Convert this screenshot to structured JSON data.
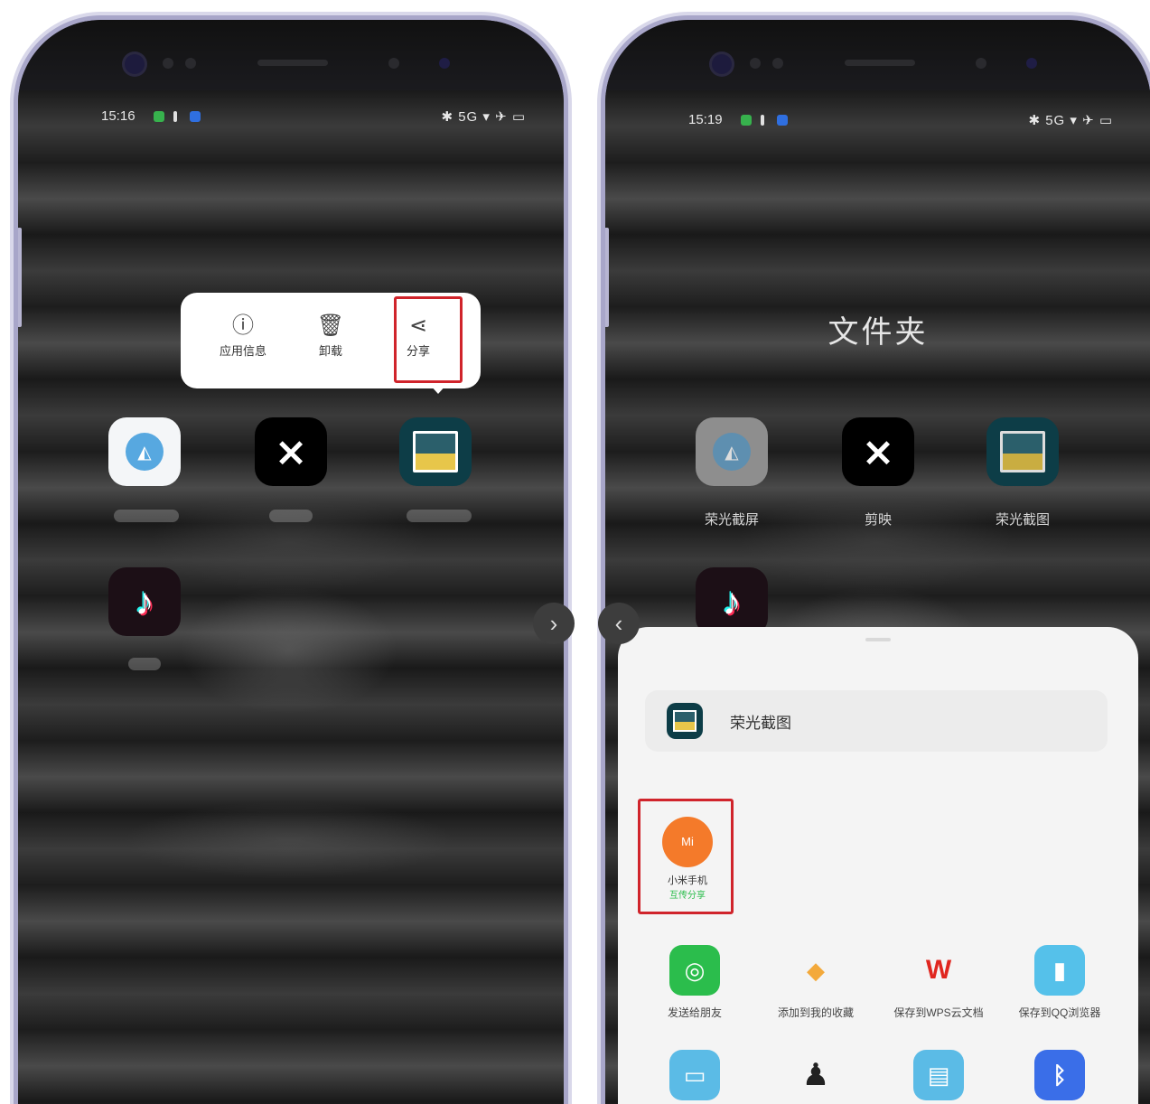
{
  "left": {
    "status": {
      "time": "15:16",
      "right": "✱ 5G ▾ ✈ ▭"
    },
    "context_menu": {
      "items": [
        {
          "label": "应用信息",
          "icon": "info-icon"
        },
        {
          "label": "卸载",
          "icon": "trash-icon"
        },
        {
          "label": "分享",
          "icon": "share-icon"
        }
      ]
    }
  },
  "right": {
    "status": {
      "time": "15:19",
      "right": "✱ 5G ▾ ✈ ▭"
    },
    "folder_title": "文件夹",
    "apps": [
      {
        "label": "荣光截屏"
      },
      {
        "label": "剪映"
      },
      {
        "label": "荣光截图"
      }
    ],
    "share_sheet": {
      "source_app": "荣光截图",
      "highlighted_target": {
        "line1": "小米手机",
        "line2": "互传分享",
        "avatar": "Mi"
      },
      "targets_row1": [
        {
          "label": "发送给朋友",
          "icon": "wechat-icon",
          "color": "#2bbd4c"
        },
        {
          "label": "添加到我的收藏",
          "icon": "box-icon",
          "color": "#f3a93b"
        },
        {
          "label": "保存到WPS云文档",
          "icon": "wps-icon",
          "color": "#e0261f"
        },
        {
          "label": "保存到QQ浏览器",
          "icon": "bookmark-icon",
          "color": "#55c1ea"
        }
      ],
      "targets_row2": [
        {
          "label": "",
          "icon": "screen-icon",
          "color": "#5bbbe6"
        },
        {
          "label": "",
          "icon": "qq-icon",
          "color": "#222222"
        },
        {
          "label": "",
          "icon": "folder-icon",
          "color": "#5bbbe6"
        },
        {
          "label": "",
          "icon": "bluetooth-icon",
          "color": "#3a6ee8"
        }
      ]
    }
  },
  "colors": {
    "highlight": "#d0242b",
    "frame": "#a8a6c9",
    "sheet": "#f4f4f4"
  }
}
